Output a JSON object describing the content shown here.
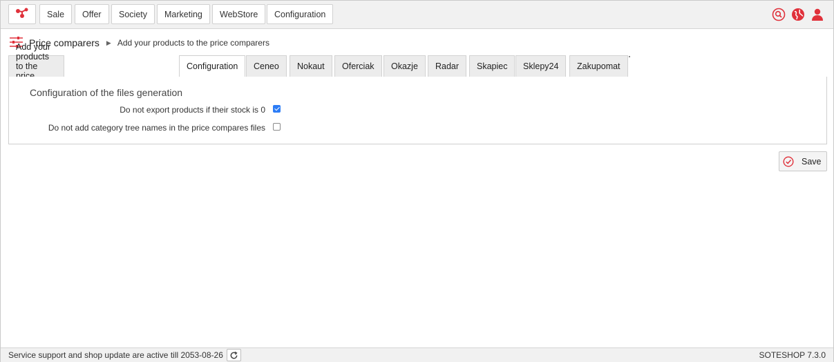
{
  "nav": {
    "logo_icon": "soteshop-logo-icon",
    "items": [
      "Sale",
      "Offer",
      "Society",
      "Marketing",
      "WebStore",
      "Configuration"
    ],
    "right_icons": [
      "search-icon",
      "globe-icon",
      "user-icon"
    ]
  },
  "breadcrumb": {
    "icon": "sliders-icon",
    "title": "Price comparers",
    "current": "Add your products to the price comparers"
  },
  "tabs": [
    {
      "label": "Add your products to the price comparers",
      "active": false
    },
    {
      "label": "Configuration",
      "active": true
    },
    {
      "label": "Ceneo",
      "active": false
    },
    {
      "label": "Nokaut",
      "active": false
    },
    {
      "label": "Oferciak",
      "active": false
    },
    {
      "label": "Okazje",
      "active": false
    },
    {
      "label": "Radar",
      "active": false
    },
    {
      "label": "Skapiec",
      "active": false
    },
    {
      "label": "Sklepy24",
      "active": false
    },
    {
      "label": "Zakupomat",
      "active": false
    }
  ],
  "config": {
    "section_title": "Configuration of the files generation",
    "options": [
      {
        "label": "Do not export products if their stock is 0",
        "checked": true
      },
      {
        "label": "Do not add category tree names in the price compares files",
        "checked": false
      }
    ]
  },
  "actions": {
    "save_label": "Save",
    "save_icon": "check-circle-icon"
  },
  "footer": {
    "support_text": "Service support and shop update are active till 2053-08-26",
    "refresh_icon": "refresh-icon",
    "version": "SOTESHOP 7.3.0"
  },
  "colors": {
    "accent": "#e0313b",
    "checkbox": "#2d7df6"
  }
}
